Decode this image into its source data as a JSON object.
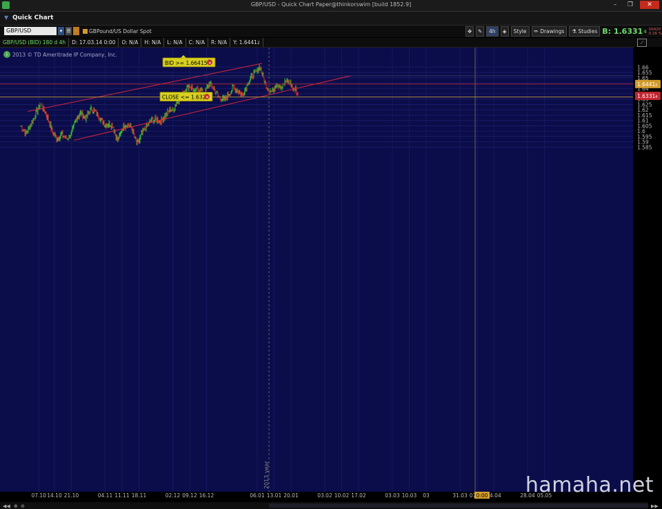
{
  "window": {
    "title": "GBP/USD - Quick Chart Paper@thinkorswim [build 1852.9]",
    "panel_title": "Quick Chart"
  },
  "toolbar": {
    "symbol": "GBP/USD",
    "description": "GBPound/US Dollar Spot",
    "timeframe": "4h",
    "style_label": "Style",
    "drawings_label": "Drawings",
    "studies_label": "Studies",
    "bid_label": "B: 1.6331",
    "bid_suffix": "4",
    "change_top": "00420",
    "change_bottom": "0.26 %"
  },
  "infobar": {
    "series": "GBP/USD (BID) 180 d 4h",
    "date": "D: 17.03.14 0:00",
    "open": "O: N/A",
    "high": "H: N/A",
    "low": "L: N/A",
    "close": "C: N/A",
    "range": "R: N/A",
    "y": "Y: 1.6441",
    "y_suffix": "2"
  },
  "copyright": "2013 © TD Ameritrade IP Company, Inc.",
  "watermark": "hamaha.net",
  "colors": {
    "background": "#0b0c4a",
    "up": "#2fbf2f",
    "down": "#d42a2a",
    "channel": "#d8263a",
    "close_line": "#c8a23c",
    "y_line": "#b5242f"
  },
  "chart_data": {
    "type": "candlestick",
    "x_tick_labels": [
      "07.10",
      "14.10",
      "21.10",
      "04.11",
      "11.11",
      "18.11",
      "02.12",
      "09.12",
      "16.12",
      "06.01",
      "13.01",
      "20.01",
      "03.02",
      "10.02",
      "17.02",
      "03.03",
      "10.03",
      "03",
      "31.03",
      "07.04",
      "14.04",
      "28.04",
      "05.05"
    ],
    "x_tick_positions": [
      7.5,
      14,
      21,
      35,
      42,
      49,
      63,
      70,
      77,
      98,
      105,
      112,
      126,
      133,
      140,
      154,
      161,
      168,
      182,
      189,
      196,
      210,
      217
    ],
    "year_label": "2013 year",
    "current_time_label": "0:00",
    "y_tick_labels": [
      "1.585",
      "1.59",
      "1.595",
      "1.6",
      "1.605",
      "1.61",
      "1.615",
      "1.62",
      "1.625",
      "1.63",
      "1.635",
      "1.64",
      "1.645",
      "1.65",
      "1.655",
      "1.66"
    ],
    "ylim": [
      1.5818,
      1.6648
    ],
    "price_markers": [
      {
        "label": "1.6441",
        "suffix": "2",
        "value": 1.6441
      },
      {
        "label": "1.6331",
        "suffix": "4",
        "value": 1.6331
      }
    ],
    "alerts": [
      {
        "label": "BID >= 1.66415",
        "value": 1.66415
      },
      {
        "label": "CLOSE <= 1.632",
        "value": 1.632
      }
    ],
    "horizontal_lines": {
      "close_alert": 1.632,
      "y_marker": 1.6441
    },
    "channel_lines": [
      {
        "from": [
          3,
          1.6185
        ],
        "to": [
          100,
          1.6635
        ]
      },
      {
        "from": [
          22,
          1.5915
        ],
        "to": [
          137,
          1.652
        ]
      }
    ],
    "path_points": [
      [
        0,
        1.605
      ],
      [
        2,
        1.598
      ],
      [
        4,
        1.605
      ],
      [
        6,
        1.615
      ],
      [
        8,
        1.625
      ],
      [
        9,
        1.622
      ],
      [
        11,
        1.614
      ],
      [
        13,
        1.6
      ],
      [
        15,
        1.593
      ],
      [
        17,
        1.597
      ],
      [
        19,
        1.593
      ],
      [
        21,
        1.597
      ],
      [
        23,
        1.612
      ],
      [
        25,
        1.617
      ],
      [
        27,
        1.612
      ],
      [
        29,
        1.621
      ],
      [
        31,
        1.618
      ],
      [
        33,
        1.612
      ],
      [
        35,
        1.606
      ],
      [
        38,
        1.606
      ],
      [
        40,
        1.592
      ],
      [
        41,
        1.595
      ],
      [
        42,
        1.603
      ],
      [
        44,
        1.607
      ],
      [
        46,
        1.603
      ],
      [
        48,
        1.588
      ],
      [
        49,
        1.59
      ],
      [
        50,
        1.597
      ],
      [
        52,
        1.604
      ],
      [
        54,
        1.61
      ],
      [
        56,
        1.611
      ],
      [
        58,
        1.609
      ],
      [
        60,
        1.615
      ],
      [
        62,
        1.62
      ],
      [
        63,
        1.619
      ],
      [
        64,
        1.625
      ],
      [
        66,
        1.632
      ],
      [
        68,
        1.638
      ],
      [
        70,
        1.643
      ],
      [
        72,
        1.637
      ],
      [
        74,
        1.64
      ],
      [
        76,
        1.634
      ],
      [
        78,
        1.645
      ],
      [
        80,
        1.64
      ],
      [
        82,
        1.632
      ],
      [
        84,
        1.629
      ],
      [
        86,
        1.634
      ],
      [
        88,
        1.641
      ],
      [
        90,
        1.638
      ],
      [
        92,
        1.634
      ],
      [
        94,
        1.645
      ],
      [
        96,
        1.652
      ],
      [
        98,
        1.656
      ],
      [
        99,
        1.661
      ],
      [
        100,
        1.653
      ],
      [
        102,
        1.641
      ],
      [
        104,
        1.637
      ],
      [
        106,
        1.645
      ],
      [
        108,
        1.64
      ],
      [
        110,
        1.648
      ],
      [
        112,
        1.644
      ],
      [
        113,
        1.638
      ],
      [
        114,
        1.64
      ],
      [
        115,
        1.633
      ]
    ]
  }
}
